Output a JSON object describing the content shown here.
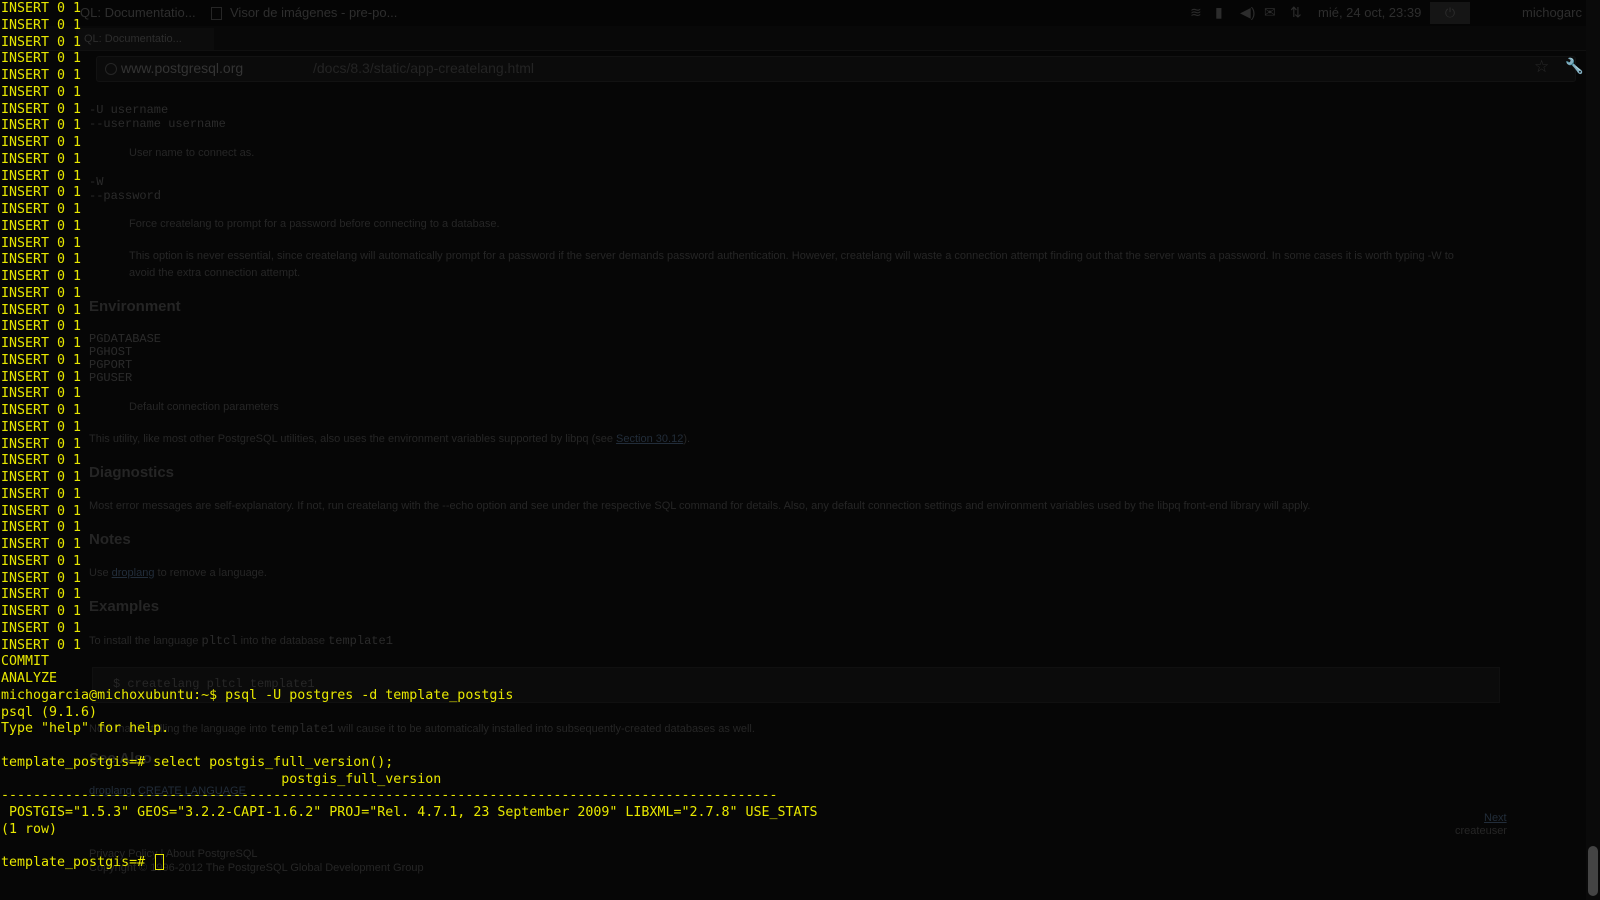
{
  "topbar": {
    "window_title_1": "QL: Documentatio...",
    "window_title_2": "Visor de imágenes - pre-po...",
    "clock": "mié, 24 oct, 23:39",
    "user": "michogarc",
    "power_glyph": "⏻",
    "tray_icons": [
      "wifi-icon",
      "battery-icon",
      "sound-icon",
      "mail-icon",
      "transfer-icon"
    ]
  },
  "browser": {
    "tab_label": "QL: Documentatio...",
    "url_host": "www.postgresql.org",
    "url_path": "/docs/8.3/static/app-createlang.html"
  },
  "doc": {
    "opt_u1": "-U username",
    "opt_u2": "--username username",
    "opt_u_desc": "User name to connect as.",
    "opt_w1": "-W",
    "opt_w2": "--password",
    "opt_w_desc": "Force createlang to prompt for a password before connecting to a database.",
    "opt_w_desc2": "This option is never essential, since createlang will automatically prompt for a password if the server demands password authentication. However, createlang will waste a connection attempt finding out that the server wants a password. In some cases it is worth typing -W to",
    "opt_w_desc3": "avoid the extra connection attempt.",
    "h_environment": "Environment",
    "env_vars": [
      "PGDATABASE",
      "PGHOST",
      "PGPORT",
      "PGUSER"
    ],
    "env_desc": "Default connection parameters",
    "env_note": "This utility, like most other PostgreSQL utilities, also uses the environment variables supported by libpq (see",
    "env_note_link": "Section 30.12",
    "env_note_end": ").",
    "h_diagnostics": "Diagnostics",
    "diag_text": "Most error messages are self-explanatory. If not, run createlang with the --echo option and see under the respective SQL command for details. Also, any default connection settings and environment variables used by the libpq front-end library will apply.",
    "h_notes": "Notes",
    "notes_pre": "Use",
    "notes_link": "droplang",
    "notes_post": "to remove a language.",
    "h_examples": "Examples",
    "examples_pre": "To install the language",
    "examples_lang": "pltcl",
    "examples_mid": "into the database",
    "examples_db": "template1",
    "examples_code": "$ createlang pltcl template1",
    "examples_note_pre": "Note that installing the language into",
    "examples_note_code": "template1",
    "examples_note_post": "will cause it to be automatically installed into subsequently-created databases as well.",
    "h_see_also": "See Also",
    "see_also_links": [
      "droplang",
      "CREATE LANGUAGE"
    ],
    "nav_next": "Next",
    "nav_next_title": "createuser",
    "footer_links": "Privacy Policy | About PostgreSQL",
    "footer_copyright": "Copyright © 1996-2012 The PostgreSQL Global Development Group"
  },
  "terminal": {
    "lines": [
      "INSERT 0 1",
      "INSERT 0 1",
      "INSERT 0 1",
      "INSERT 0 1",
      "INSERT 0 1",
      "INSERT 0 1",
      "INSERT 0 1",
      "INSERT 0 1",
      "INSERT 0 1",
      "INSERT 0 1",
      "INSERT 0 1",
      "INSERT 0 1",
      "INSERT 0 1",
      "INSERT 0 1",
      "INSERT 0 1",
      "INSERT 0 1",
      "INSERT 0 1",
      "INSERT 0 1",
      "INSERT 0 1",
      "INSERT 0 1",
      "INSERT 0 1",
      "INSERT 0 1",
      "INSERT 0 1",
      "INSERT 0 1",
      "INSERT 0 1",
      "INSERT 0 1",
      "INSERT 0 1",
      "INSERT 0 1",
      "INSERT 0 1",
      "INSERT 0 1",
      "INSERT 0 1",
      "INSERT 0 1",
      "INSERT 0 1",
      "INSERT 0 1",
      "INSERT 0 1",
      "INSERT 0 1",
      "INSERT 0 1",
      "INSERT 0 1",
      "INSERT 0 1",
      "COMMIT",
      "ANALYZE",
      "michogarcia@michoxubuntu:~$ psql -U postgres -d template_postgis",
      "psql (9.1.6)",
      "Type \"help\" for help.",
      "",
      "template_postgis=# select postgis_full_version();",
      "                                   postgis_full_version",
      "-------------------------------------------------------------------------------------------------",
      " POSTGIS=\"1.5.3\" GEOS=\"3.2.2-CAPI-1.6.2\" PROJ=\"Rel. 4.7.1, 23 September 2009\" LIBXML=\"2.7.8\" USE_STATS",
      "(1 row)",
      ""
    ],
    "prompt": "template_postgis=# ",
    "text_color": "#e8e800",
    "background": "#060606"
  }
}
